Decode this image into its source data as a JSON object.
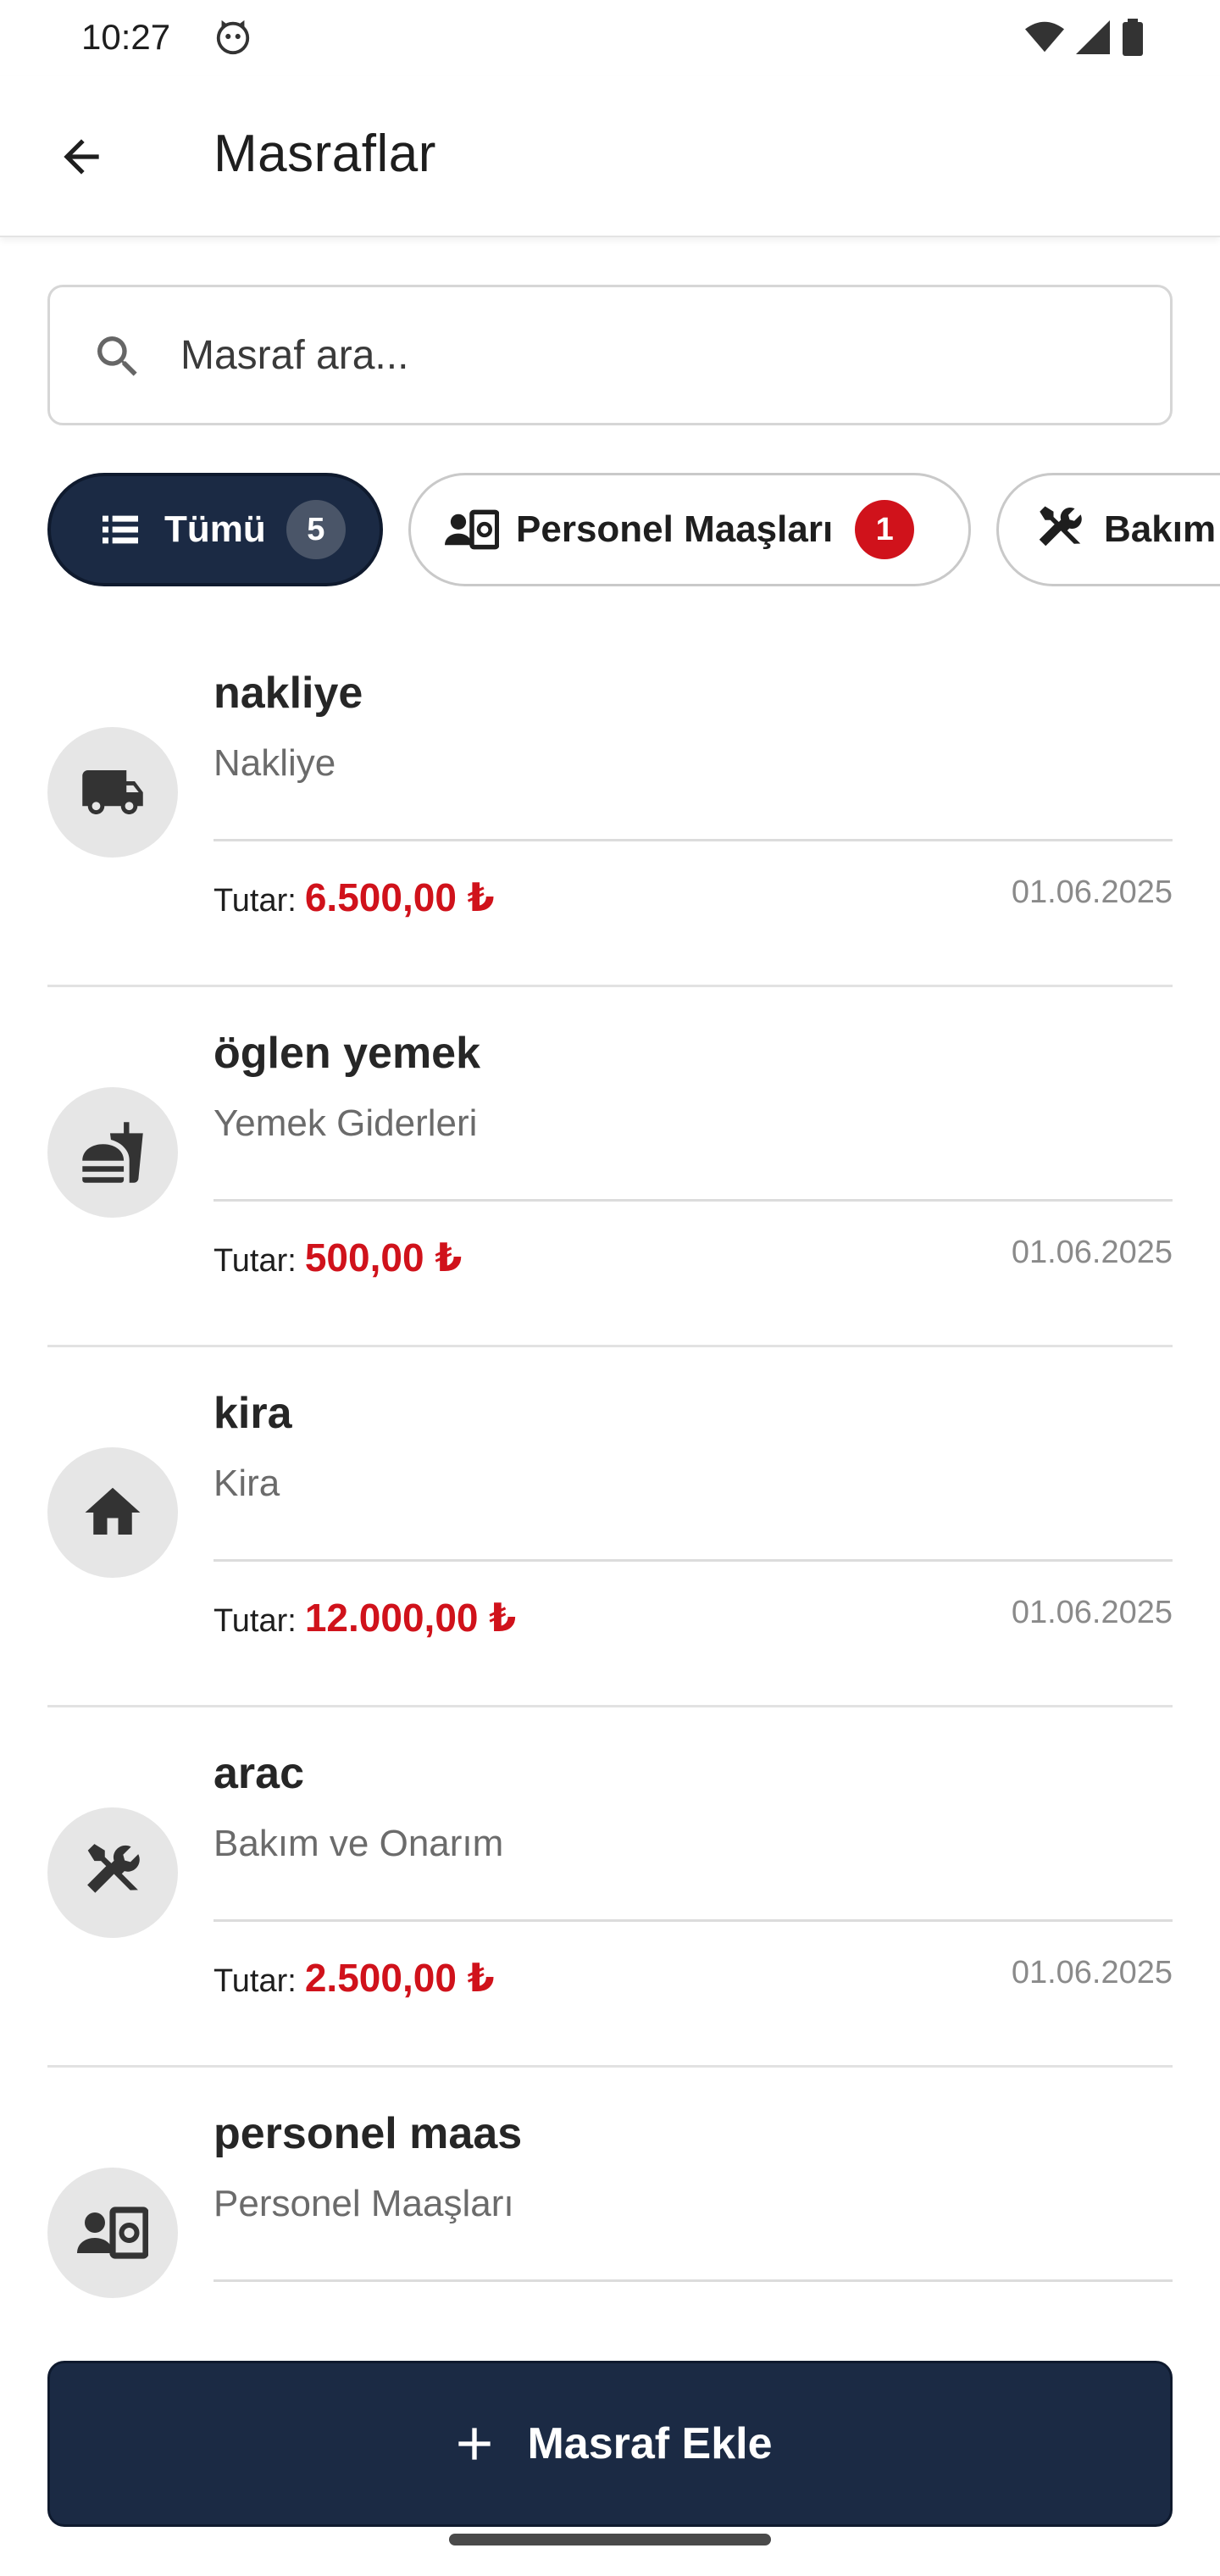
{
  "status_bar": {
    "time": "10:27"
  },
  "app_bar": {
    "title": "Masraflar"
  },
  "search": {
    "placeholder": "Masraf ara..."
  },
  "chips": [
    {
      "label": "Tümü",
      "count": "5",
      "icon": "list-icon",
      "selected": true
    },
    {
      "label": "Personel Maaşları",
      "count": "1",
      "icon": "payroll-icon",
      "selected": false
    },
    {
      "label": "Bakım",
      "icon": "tools-icon",
      "selected": false
    }
  ],
  "expenses": [
    {
      "name": "nakliye",
      "category": "Nakliye",
      "amount_label": "Tutar:",
      "amount": "6.500,00 ₺",
      "date": "01.06.2025",
      "icon": "truck-icon"
    },
    {
      "name": "öglen yemek",
      "category": "Yemek Giderleri",
      "amount_label": "Tutar:",
      "amount": "500,00 ₺",
      "date": "01.06.2025",
      "icon": "fastfood-icon"
    },
    {
      "name": "kira",
      "category": "Kira",
      "amount_label": "Tutar:",
      "amount": "12.000,00 ₺",
      "date": "01.06.2025",
      "icon": "home-icon"
    },
    {
      "name": "arac",
      "category": "Bakım ve Onarım",
      "amount_label": "Tutar:",
      "amount": "2.500,00 ₺",
      "date": "01.06.2025",
      "icon": "tools-icon"
    },
    {
      "name": "personel maas",
      "category": "Personel Maaşları",
      "icon": "payroll-icon"
    }
  ],
  "add_button": {
    "label": "Masraf Ekle"
  },
  "colors": {
    "primary": "#1b2a44",
    "amount": "#d0121b",
    "badge": "#d0121b"
  }
}
